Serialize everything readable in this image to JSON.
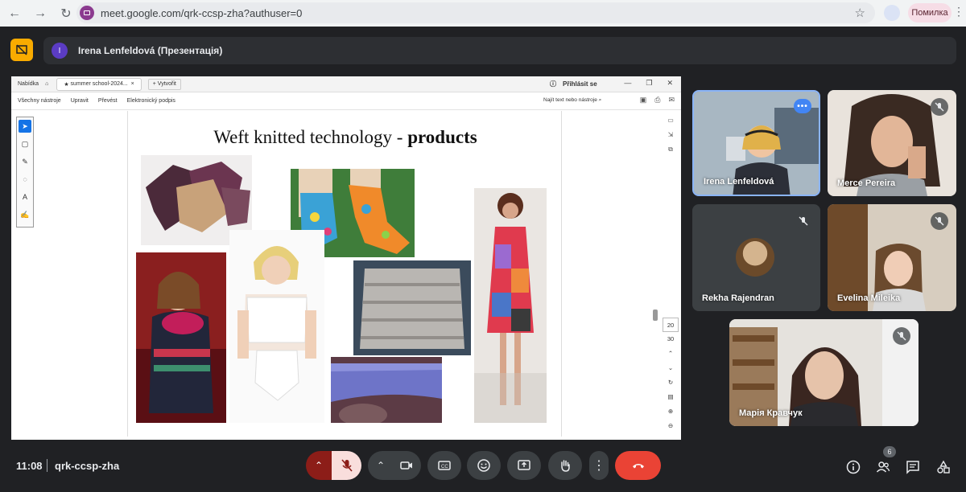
{
  "browser": {
    "url": "meet.google.com/qrk-ccsp-zha?authuser=0",
    "error_chip": "Помилка"
  },
  "banner": {
    "avatar_letter": "I",
    "title": "Irena Lenfeldová (Презентація)"
  },
  "shared_screen": {
    "tabs": {
      "menu": "Nabídka",
      "active_tab": "summer school-2024...",
      "new_tab": "Vytvořit"
    },
    "login": "Přihlásit se",
    "toolbar": {
      "items": [
        "Všechny nástroje",
        "Upravit",
        "Převést",
        "Elektronický podpis"
      ],
      "search_placeholder": "Najít text nebo nástroje"
    },
    "slide": {
      "title_regular": "Weft knitted technology - ",
      "title_bold": "products"
    },
    "zoom": {
      "page_current": "20",
      "page_total": "30"
    }
  },
  "participants": [
    {
      "name": "Irena Lenfeldová",
      "speaking": true
    },
    {
      "name": "Merce Pereira",
      "muted": true
    },
    {
      "name": "Rekha Rajendran",
      "muted": true
    },
    {
      "name": "Evelina Mileika",
      "muted": true
    },
    {
      "name": "Марія Кравчук",
      "muted": true
    }
  ],
  "footer": {
    "time": "11:08",
    "meeting_code": "qrk-ccsp-zha",
    "participant_count": "6"
  },
  "colors": {
    "background": "#202124",
    "end_call": "#ea4335",
    "mic_off": "#f9dedc",
    "present_off": "#f9ab00",
    "speaking_border": "#8ab4f8"
  }
}
